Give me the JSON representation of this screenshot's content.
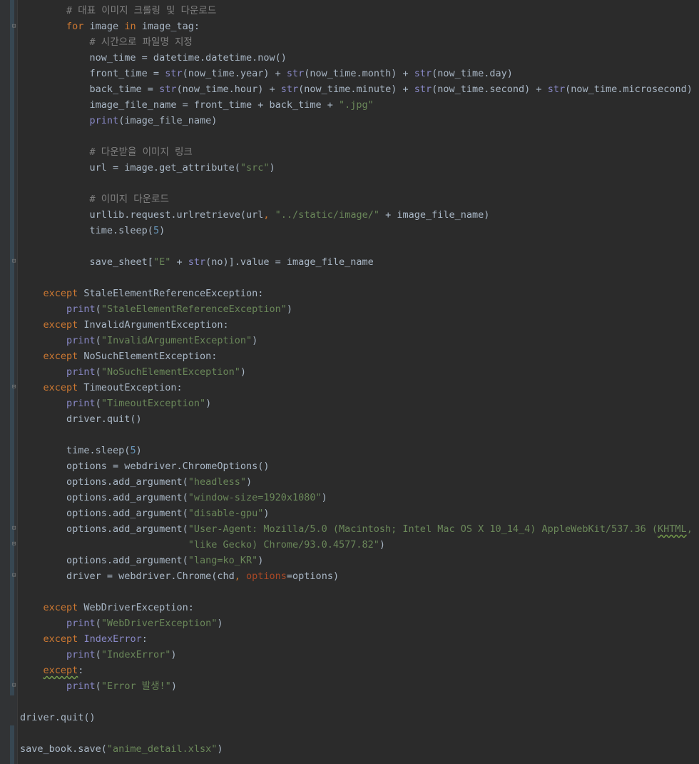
{
  "editor": {
    "lines": [
      [
        {
          "t": "        "
        },
        {
          "t": "# 대표 이미지 크롤링 및 다운로드",
          "c": "cm"
        }
      ],
      [
        {
          "t": "        "
        },
        {
          "t": "for",
          "c": "kw"
        },
        {
          "t": " image "
        },
        {
          "t": "in",
          "c": "kw"
        },
        {
          "t": " image_tag:"
        }
      ],
      [
        {
          "t": "            "
        },
        {
          "t": "# 시간으로 파일명 지정",
          "c": "cm"
        }
      ],
      [
        {
          "t": "            now_time = datetime.datetime.now()"
        }
      ],
      [
        {
          "t": "            front_time = "
        },
        {
          "t": "str",
          "c": "bi"
        },
        {
          "t": "(now_time.year) + "
        },
        {
          "t": "str",
          "c": "bi"
        },
        {
          "t": "(now_time.month) + "
        },
        {
          "t": "str",
          "c": "bi"
        },
        {
          "t": "(now_time.day)"
        }
      ],
      [
        {
          "t": "            back_time = "
        },
        {
          "t": "str",
          "c": "bi"
        },
        {
          "t": "(now_time.hour) + "
        },
        {
          "t": "str",
          "c": "bi"
        },
        {
          "t": "(now_time.minute) + "
        },
        {
          "t": "str",
          "c": "bi"
        },
        {
          "t": "(now_time.second) + "
        },
        {
          "t": "str",
          "c": "bi"
        },
        {
          "t": "(now_time.microsecond)"
        }
      ],
      [
        {
          "t": "            image_file_name = front_time + back_time + "
        },
        {
          "t": "\".jpg\"",
          "c": "st"
        }
      ],
      [
        {
          "t": "            "
        },
        {
          "t": "print",
          "c": "bi"
        },
        {
          "t": "(image_file_name)"
        }
      ],
      [
        {
          "t": ""
        }
      ],
      [
        {
          "t": "            "
        },
        {
          "t": "# 다운받을 이미지 링크",
          "c": "cm"
        }
      ],
      [
        {
          "t": "            url = image.get_attribute("
        },
        {
          "t": "\"src\"",
          "c": "st"
        },
        {
          "t": ")"
        }
      ],
      [
        {
          "t": ""
        }
      ],
      [
        {
          "t": "            "
        },
        {
          "t": "# 이미지 다운로드",
          "c": "cm"
        }
      ],
      [
        {
          "t": "            urllib.request.urlretrieve(url"
        },
        {
          "t": ",",
          "c": "kw"
        },
        {
          "t": " "
        },
        {
          "t": "\"../static/image/\"",
          "c": "st"
        },
        {
          "t": " + image_file_name)"
        }
      ],
      [
        {
          "t": "            time.sleep("
        },
        {
          "t": "5",
          "c": "nm"
        },
        {
          "t": ")"
        }
      ],
      [
        {
          "t": ""
        }
      ],
      [
        {
          "t": "            save_sheet["
        },
        {
          "t": "\"E\"",
          "c": "st"
        },
        {
          "t": " + "
        },
        {
          "t": "str",
          "c": "bi"
        },
        {
          "t": "(no)].value = image_file_name"
        }
      ],
      [
        {
          "t": ""
        }
      ],
      [
        {
          "t": "    "
        },
        {
          "t": "except",
          "c": "kw"
        },
        {
          "t": " StaleElementReferenceException:"
        }
      ],
      [
        {
          "t": "        "
        },
        {
          "t": "print",
          "c": "bi"
        },
        {
          "t": "("
        },
        {
          "t": "\"StaleElementReferenceException\"",
          "c": "st"
        },
        {
          "t": ")"
        }
      ],
      [
        {
          "t": "    "
        },
        {
          "t": "except",
          "c": "kw"
        },
        {
          "t": " InvalidArgumentException:"
        }
      ],
      [
        {
          "t": "        "
        },
        {
          "t": "print",
          "c": "bi"
        },
        {
          "t": "("
        },
        {
          "t": "\"InvalidArgumentException\"",
          "c": "st"
        },
        {
          "t": ")"
        }
      ],
      [
        {
          "t": "    "
        },
        {
          "t": "except",
          "c": "kw"
        },
        {
          "t": " NoSuchElementException:"
        }
      ],
      [
        {
          "t": "        "
        },
        {
          "t": "print",
          "c": "bi"
        },
        {
          "t": "("
        },
        {
          "t": "\"NoSuchElementException\"",
          "c": "st"
        },
        {
          "t": ")"
        }
      ],
      [
        {
          "t": "    "
        },
        {
          "t": "except",
          "c": "kw"
        },
        {
          "t": " TimeoutException:"
        }
      ],
      [
        {
          "t": "        "
        },
        {
          "t": "print",
          "c": "bi"
        },
        {
          "t": "("
        },
        {
          "t": "\"TimeoutException\"",
          "c": "st"
        },
        {
          "t": ")"
        }
      ],
      [
        {
          "t": "        driver.quit()"
        }
      ],
      [
        {
          "t": ""
        }
      ],
      [
        {
          "t": "        time.sleep("
        },
        {
          "t": "5",
          "c": "nm"
        },
        {
          "t": ")"
        }
      ],
      [
        {
          "t": "        options = webdriver.ChromeOptions()"
        }
      ],
      [
        {
          "t": "        options.add_argument("
        },
        {
          "t": "\"headless\"",
          "c": "st"
        },
        {
          "t": ")"
        }
      ],
      [
        {
          "t": "        options.add_argument("
        },
        {
          "t": "\"window-size=1920x1080\"",
          "c": "st"
        },
        {
          "t": ")"
        }
      ],
      [
        {
          "t": "        options.add_argument("
        },
        {
          "t": "\"disable-gpu\"",
          "c": "st"
        },
        {
          "t": ")"
        }
      ],
      [
        {
          "t": "        options.add_argument("
        },
        {
          "t": "\"User-Agent: Mozilla/5.0 (Macintosh; Intel Mac OS X 10_14_4) AppleWebKit/537.36 (",
          "c": "st"
        },
        {
          "t": "KHTML",
          "c": "st",
          "u": true
        },
        {
          "t": ", \"",
          "c": "st"
        }
      ],
      [
        {
          "t": "                             "
        },
        {
          "t": "\"like Gecko) Chrome/93.0.4577.82\"",
          "c": "st"
        },
        {
          "t": ")"
        }
      ],
      [
        {
          "t": "        options.add_argument("
        },
        {
          "t": "\"lang=ko_KR\"",
          "c": "st"
        },
        {
          "t": ")"
        }
      ],
      [
        {
          "t": "        driver = webdriver.Chrome(chd"
        },
        {
          "t": ",",
          "c": "kw"
        },
        {
          "t": " "
        },
        {
          "t": "options",
          "c": "pa"
        },
        {
          "t": "=options)"
        }
      ],
      [
        {
          "t": ""
        }
      ],
      [
        {
          "t": "    "
        },
        {
          "t": "except",
          "c": "kw"
        },
        {
          "t": " WebDriverException:"
        }
      ],
      [
        {
          "t": "        "
        },
        {
          "t": "print",
          "c": "bi"
        },
        {
          "t": "("
        },
        {
          "t": "\"WebDriverException\"",
          "c": "st"
        },
        {
          "t": ")"
        }
      ],
      [
        {
          "t": "    "
        },
        {
          "t": "except",
          "c": "kw"
        },
        {
          "t": " "
        },
        {
          "t": "IndexError",
          "c": "bi"
        },
        {
          "t": ":"
        }
      ],
      [
        {
          "t": "        "
        },
        {
          "t": "print",
          "c": "bi"
        },
        {
          "t": "("
        },
        {
          "t": "\"IndexError\"",
          "c": "st"
        },
        {
          "t": ")"
        }
      ],
      [
        {
          "t": "    "
        },
        {
          "t": "except",
          "c": "kw",
          "u": true
        },
        {
          "t": ":"
        }
      ],
      [
        {
          "t": "        "
        },
        {
          "t": "print",
          "c": "bi"
        },
        {
          "t": "("
        },
        {
          "t": "\"Error 발생!\"",
          "c": "st"
        },
        {
          "t": ")"
        }
      ],
      [
        {
          "t": ""
        }
      ],
      [
        {
          "t": "driver.quit()"
        }
      ],
      [
        {
          "t": ""
        }
      ],
      [
        {
          "t": "save_book.save("
        },
        {
          "t": "\"anime_detail.xlsx\"",
          "c": "st"
        },
        {
          "t": ")"
        }
      ]
    ],
    "colors": {
      "background": "#2b2b2b",
      "keyword": "#cc7832",
      "builtin": "#8888c6",
      "string": "#6a8759",
      "number": "#6897bb",
      "comment": "#808080",
      "parameter": "#aa4926",
      "text": "#a9b7c6"
    }
  }
}
